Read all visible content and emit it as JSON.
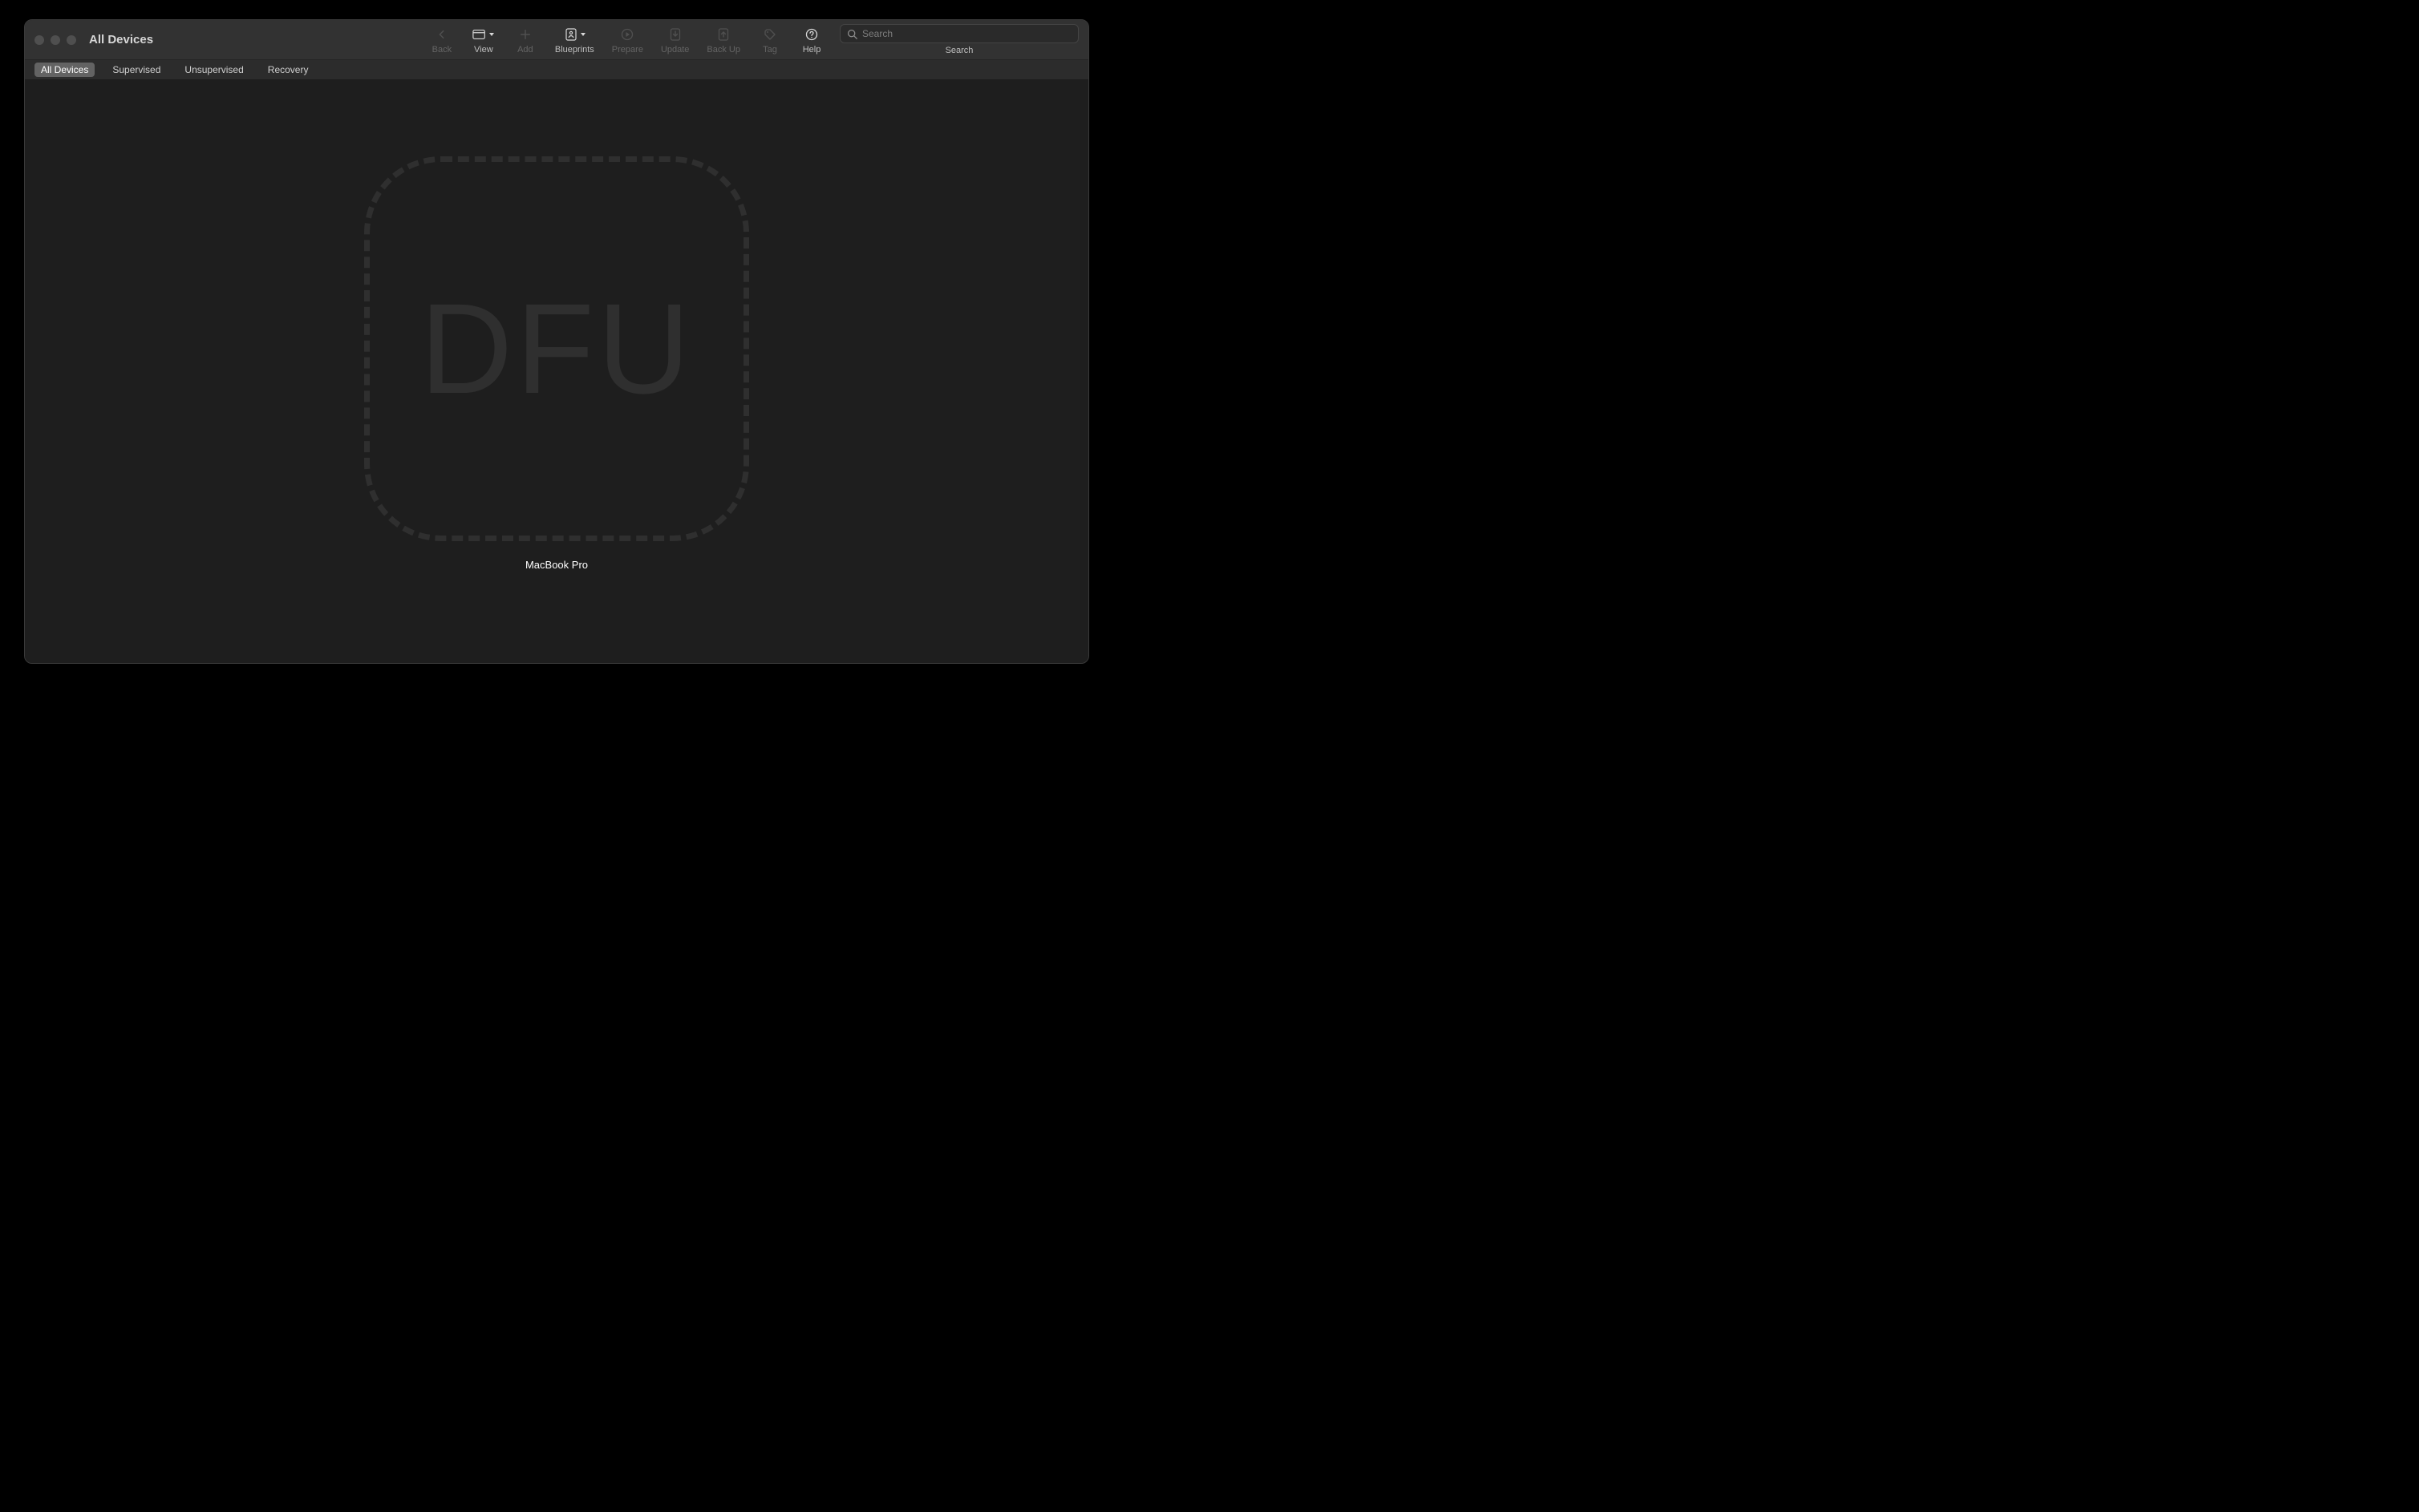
{
  "window": {
    "title": "All Devices"
  },
  "toolbar": {
    "back": {
      "label": "Back",
      "enabled": false
    },
    "view": {
      "label": "View",
      "enabled": true
    },
    "add": {
      "label": "Add",
      "enabled": false
    },
    "blueprints": {
      "label": "Blueprints",
      "enabled": true
    },
    "prepare": {
      "label": "Prepare",
      "enabled": false
    },
    "update": {
      "label": "Update",
      "enabled": false
    },
    "backup": {
      "label": "Back Up",
      "enabled": false
    },
    "tag": {
      "label": "Tag",
      "enabled": false
    },
    "help": {
      "label": "Help",
      "enabled": true
    }
  },
  "search": {
    "placeholder": "Search",
    "label": "Search",
    "value": ""
  },
  "scopebar": {
    "items": [
      {
        "label": "All Devices",
        "active": true
      },
      {
        "label": "Supervised",
        "active": false
      },
      {
        "label": "Unsupervised",
        "active": false
      },
      {
        "label": "Recovery",
        "active": false
      }
    ]
  },
  "device": {
    "badge": "DFU",
    "name": "MacBook Pro"
  }
}
